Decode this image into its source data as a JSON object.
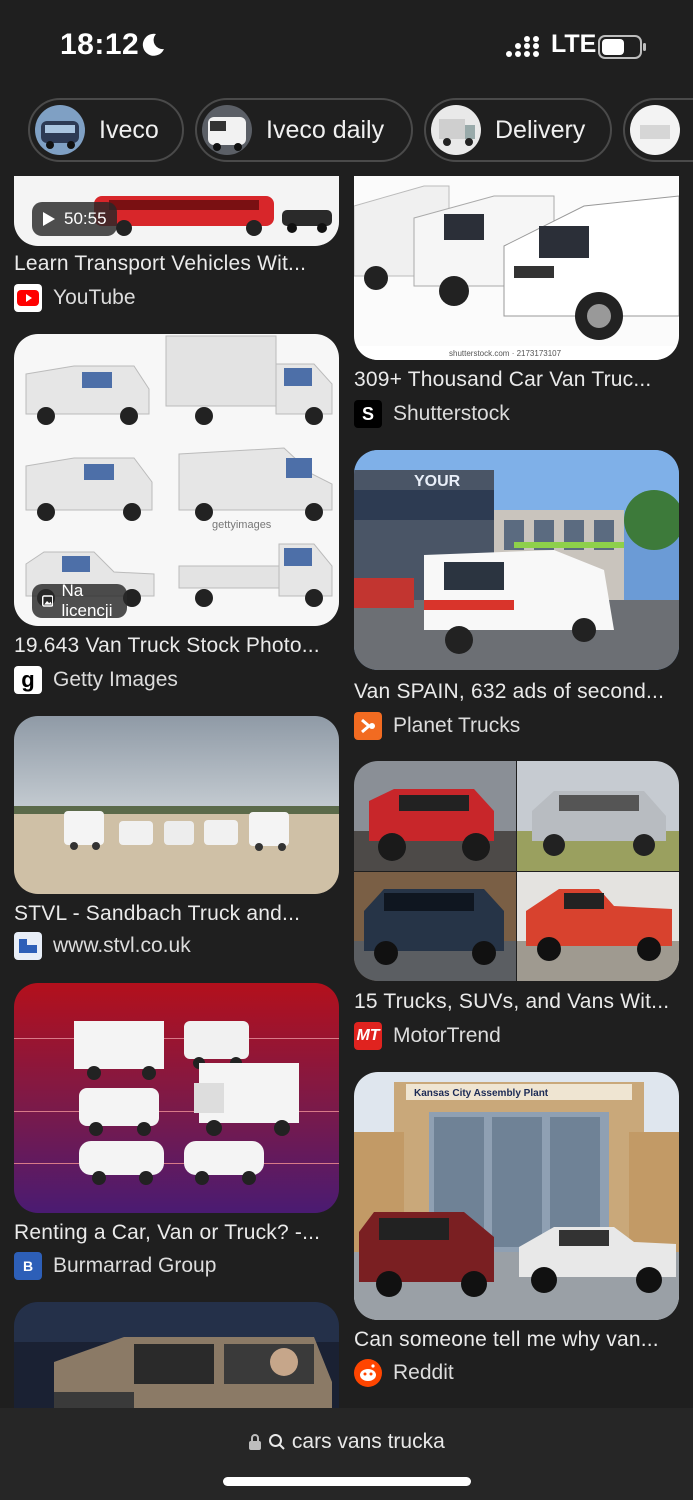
{
  "status": {
    "time": "18:12",
    "network": "LTE"
  },
  "chips": [
    {
      "label": "Iveco"
    },
    {
      "label": "Iveco daily"
    },
    {
      "label": "Delivery"
    },
    {
      "label": ""
    }
  ],
  "results": [
    {
      "title": "Learn Transport Vehicles Wit...",
      "source": "YouTube",
      "badge": "50:55"
    },
    {
      "title": "309+ Thousand Car Van Truc...",
      "source": "Shutterstock",
      "watermark": "shutterstock.com · 2173173107"
    },
    {
      "title": "19.643 Van Truck Stock Photo...",
      "source": "Getty Images",
      "badge": "Na licencji",
      "watermark": "gettyimages"
    },
    {
      "title": "Van SPAIN, 632 ads of second...",
      "source": "Planet Trucks"
    },
    {
      "title": "STVL - Sandbach Truck and...",
      "source": "www.stvl.co.uk"
    },
    {
      "title": "15 Trucks, SUVs, and Vans Wit...",
      "source": "MotorTrend"
    },
    {
      "title": "Renting a Car, Van or Truck? -...",
      "source": "Burmarrad Group"
    },
    {
      "title": "Can someone tell me why van...",
      "source": "Reddit",
      "sign": "Kansas City Assembly Plant"
    },
    {
      "title": "",
      "source": ""
    }
  ],
  "address_bar": {
    "url": "cars vans trucka"
  },
  "colors": {
    "background": "#1f1f1f",
    "youtube": "#ff0000",
    "motortrend": "#e0231f",
    "reddit": "#ff4500",
    "planet_trucks": "#f26b21"
  },
  "icons": {
    "status": [
      "moon-icon",
      "signal-icon",
      "battery-icon"
    ],
    "address": [
      "lock-icon",
      "search-icon"
    ],
    "badge": [
      "play-icon",
      "image-icon"
    ]
  }
}
